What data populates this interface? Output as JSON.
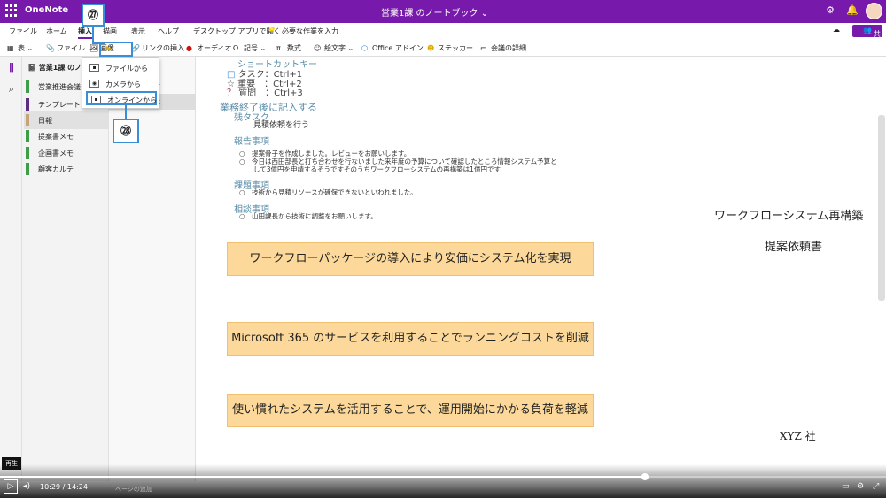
{
  "app": {
    "name": "OneNote",
    "notebook_title": "営業1課 のノートブック"
  },
  "menu": {
    "items": [
      "ファイル",
      "ホーム",
      "挿入",
      "描画",
      "表示",
      "ヘルプ",
      "デスクトップ アプリで開く"
    ],
    "active_index": 2,
    "search_placeholder": "必要な作業を入力",
    "share_label": "共有"
  },
  "ribbon": {
    "table": "表",
    "file": "ファイル",
    "image": "画像",
    "link": "リンクの挿入",
    "audio": "オーディオ",
    "symbol": "記号",
    "equation": "数式",
    "emoji": "絵文字",
    "office_addin": "Office アドイン",
    "sticker": "ステッカー",
    "meeting": "会議の詳細"
  },
  "image_menu": {
    "items": [
      "ファイルから",
      "カメラから",
      "オンラインから"
    ],
    "highlighted_index": 2
  },
  "callouts": {
    "first": "㉗",
    "second": "㉘"
  },
  "sidebar": {
    "notebook": "営業1課 のノート",
    "sections": [
      {
        "label": "営業推進会議",
        "color": "#3d9e4a"
      },
      {
        "label": "テンプレート",
        "color": "#5b2d84"
      },
      {
        "label": "日報",
        "color": "#c8a27a"
      },
      {
        "label": "提案書メモ",
        "color": "#3d9e4a"
      },
      {
        "label": "企画書メモ",
        "color": "#3d9e4a"
      },
      {
        "label": "顧客カルテ",
        "color": "#3d9e4a"
      }
    ],
    "selected_section": 2,
    "pages": [
      "木",
      "木"
    ],
    "selected_page": 1,
    "add_page": "ページの追加"
  },
  "note": {
    "shortcut_title": "ショートカットキー",
    "shortcuts": [
      {
        "icon": "□",
        "text": "タスク：Ctrl+1"
      },
      {
        "icon": "☆",
        "text": "重要　：Ctrl+2"
      },
      {
        "icon": "？",
        "text": "質問　：Ctrl+3"
      }
    ],
    "after_work": "業務終了後に記入する",
    "remaining_title": "残タスク",
    "remaining_item": "見積依頼を行う",
    "report_title": "報告事項",
    "report_items": [
      "提案骨子を作成しました。レビューをお願いします。",
      "今日は西田部長と打ち合わせを行ないました来年度の予算について確認したところ情報システム予算と",
      "して3億円を申請するそうですそのうちワークフローシステムの再構築は1億円です"
    ],
    "issue_title": "課題事項",
    "issue_item": "技術から見積リソースが確保できないといわれました。",
    "consult_title": "相談事項",
    "consult_item": "山田課長から技術に調整をお願いします。",
    "boxes": [
      "ワークフローパッケージの導入により安価にシステム化を実現",
      "Microsoft 365 のサービスを利用することでランニングコストを削減",
      "使い慣れたシステムを活用することで、運用開始にかかる負荷を軽減"
    ],
    "slide_title": "ワークフローシステム再構築",
    "slide_subtitle": "提案依頼書",
    "slide_company": "XYZ 社"
  },
  "video": {
    "tooltip": "再生",
    "current": "10:29",
    "total": "14:24",
    "separator": "/",
    "progress": 0.728
  }
}
